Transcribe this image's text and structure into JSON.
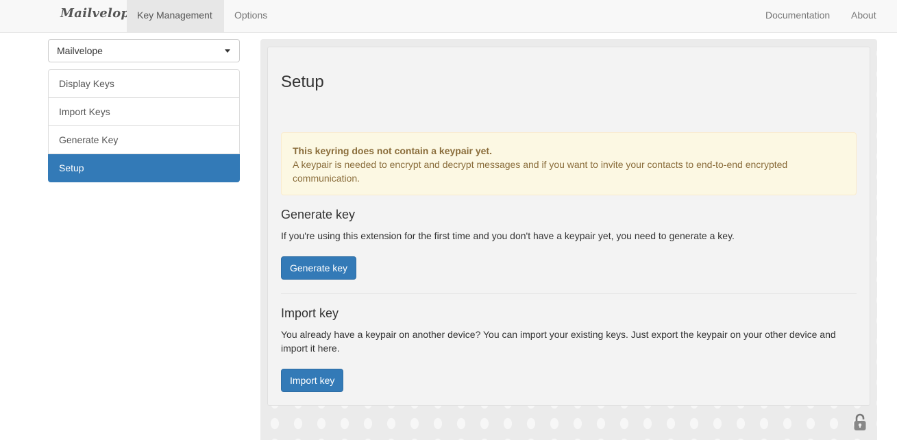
{
  "navbar": {
    "brand": "Mailvelope",
    "items": [
      {
        "label": "Key Management",
        "active": true
      },
      {
        "label": "Options",
        "active": false
      }
    ],
    "right_items": [
      {
        "label": "Documentation"
      },
      {
        "label": "About"
      }
    ]
  },
  "sidebar": {
    "keyring_select": {
      "value": "Mailvelope"
    },
    "items": [
      {
        "label": "Display Keys",
        "active": false
      },
      {
        "label": "Import Keys",
        "active": false
      },
      {
        "label": "Generate Key",
        "active": false
      },
      {
        "label": "Setup",
        "active": true
      }
    ]
  },
  "main": {
    "title": "Setup",
    "alert": {
      "heading": "This keyring does not contain a keypair yet.",
      "text": "A keypair is needed to encrypt and decrypt messages and if you want to invite your contacts to end-to-end encrypted communication."
    },
    "generate": {
      "title": "Generate key",
      "text": "If you're using this extension for the first time and you don't have a keypair yet, you need to generate a key.",
      "button": "Generate key"
    },
    "import": {
      "title": "Import key",
      "text": "You already have a keypair on another device? You can import your existing keys. Just export the keypair on your other device and import it here.",
      "button": "Import key"
    }
  },
  "colors": {
    "primary": "#337ab7",
    "alert_bg": "#fcf8e3",
    "alert_text": "#8a6d3b",
    "navbar_bg": "#f8f8f8"
  },
  "icons": {
    "status": "lock-open-icon",
    "dropdown": "caret-down-icon"
  }
}
